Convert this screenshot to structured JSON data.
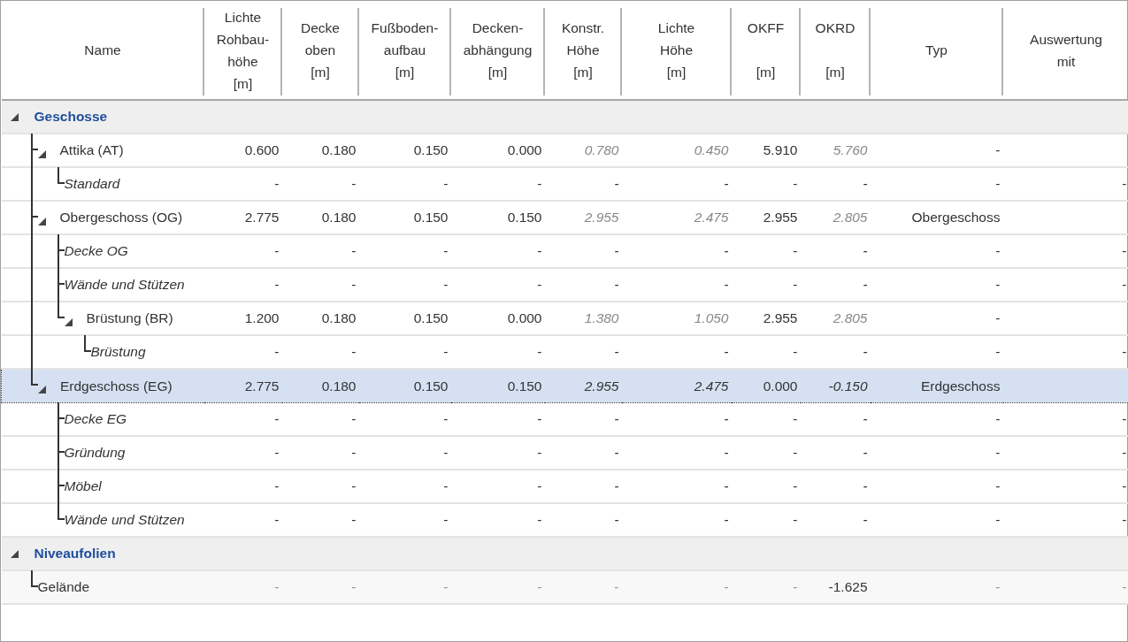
{
  "columns": [
    {
      "label": "Name",
      "derived": false
    },
    {
      "label": "Lichte\nRohbau-\nhöhe\n[m]",
      "derived": false
    },
    {
      "label": "Decke\noben\n[m]",
      "derived": false
    },
    {
      "label": "Fußboden-\naufbau\n[m]",
      "derived": false
    },
    {
      "label": "Decken-\nabhängung\n[m]",
      "derived": false
    },
    {
      "label": "Konstr.\nHöhe\n[m]",
      "derived": true
    },
    {
      "label": "Lichte\nHöhe\n[m]",
      "derived": true
    },
    {
      "label": "OKFF\n\n[m]",
      "derived": false
    },
    {
      "label": "OKRD\n\n[m]",
      "derived": true
    },
    {
      "label": "Typ",
      "derived": false
    },
    {
      "label": "Auswertung\nmit",
      "derived": false
    }
  ],
  "rows": [
    {
      "kind": "group",
      "label": "Geschosse",
      "expanded": true,
      "selected": false,
      "children": [
        {
          "kind": "floor",
          "label": "Attika (AT)",
          "expanded": true,
          "selected": false,
          "values": [
            "0.600",
            "0.180",
            "0.150",
            "0.000",
            "0.780",
            "0.450",
            "5.910",
            "5.760",
            "-"
          ],
          "children": [
            {
              "kind": "layer",
              "label": "Standard",
              "selected": false,
              "values": [
                "-",
                "-",
                "-",
                "-",
                "-",
                "-",
                "-",
                "-",
                "-",
                "-"
              ]
            }
          ]
        },
        {
          "kind": "floor",
          "label": "Obergeschoss (OG)",
          "expanded": true,
          "selected": false,
          "values": [
            "2.775",
            "0.180",
            "0.150",
            "0.150",
            "2.955",
            "2.475",
            "2.955",
            "2.805",
            "Obergeschoss"
          ],
          "children": [
            {
              "kind": "layer",
              "label": "Decke OG",
              "selected": false,
              "values": [
                "-",
                "-",
                "-",
                "-",
                "-",
                "-",
                "-",
                "-",
                "-",
                "-"
              ]
            },
            {
              "kind": "layer",
              "label": "Wände und Stützen",
              "selected": false,
              "values": [
                "-",
                "-",
                "-",
                "-",
                "-",
                "-",
                "-",
                "-",
                "-",
                "-"
              ]
            },
            {
              "kind": "floor",
              "label": "Brüstung (BR)",
              "expanded": true,
              "selected": false,
              "values": [
                "1.200",
                "0.180",
                "0.150",
                "0.000",
                "1.380",
                "1.050",
                "2.955",
                "2.805",
                "-"
              ],
              "children": [
                {
                  "kind": "layer",
                  "label": "Brüstung",
                  "selected": false,
                  "values": [
                    "-",
                    "-",
                    "-",
                    "-",
                    "-",
                    "-",
                    "-",
                    "-",
                    "-",
                    "-"
                  ]
                }
              ]
            }
          ]
        },
        {
          "kind": "floor",
          "label": "Erdgeschoss (EG)",
          "expanded": true,
          "selected": true,
          "values": [
            "2.775",
            "0.180",
            "0.150",
            "0.150",
            "2.955",
            "2.475",
            "0.000",
            "-0.150",
            "Erdgeschoss"
          ],
          "children": [
            {
              "kind": "layer",
              "label": "Decke EG",
              "selected": false,
              "values": [
                "-",
                "-",
                "-",
                "-",
                "-",
                "-",
                "-",
                "-",
                "-",
                "-"
              ]
            },
            {
              "kind": "layer",
              "label": "Gründung",
              "selected": false,
              "values": [
                "-",
                "-",
                "-",
                "-",
                "-",
                "-",
                "-",
                "-",
                "-",
                "-"
              ]
            },
            {
              "kind": "layer",
              "label": "Möbel",
              "selected": false,
              "values": [
                "-",
                "-",
                "-",
                "-",
                "-",
                "-",
                "-",
                "-",
                "-",
                "-"
              ]
            },
            {
              "kind": "layer",
              "label": "Wände und Stützen",
              "selected": false,
              "values": [
                "-",
                "-",
                "-",
                "-",
                "-",
                "-",
                "-",
                "-",
                "-",
                "-"
              ]
            }
          ]
        }
      ]
    },
    {
      "kind": "group",
      "label": "Niveaufolien",
      "expanded": true,
      "selected": false,
      "children": [
        {
          "kind": "level",
          "label": "Gelände",
          "selected": false,
          "values": [
            "-",
            "-",
            "-",
            "-",
            "-",
            "-",
            "-",
            "-1.625",
            "-",
            "-"
          ]
        }
      ]
    }
  ]
}
